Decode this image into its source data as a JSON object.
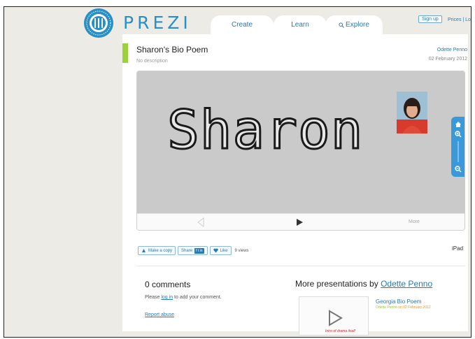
{
  "header": {
    "logo_text": "PREZI",
    "tabs": [
      {
        "label": "Create"
      },
      {
        "label": "Learn"
      },
      {
        "label": "Explore"
      }
    ],
    "signup_label": "Sign up",
    "links": "Prices | Lo"
  },
  "presentation": {
    "title": "Sharon's Bio Poem",
    "description": "No description",
    "author": "Odette Penno",
    "date": "02 February 2012"
  },
  "viewer": {
    "big_word": "Sharon",
    "more_label": "More"
  },
  "actions": {
    "copy_label": "Make a copy",
    "share_label": "Share",
    "share_badge": "f t in",
    "like_label": "Like",
    "views": "9 views",
    "ipad_label": "iPad"
  },
  "comments": {
    "title": "0 comments",
    "hint_prefix": "Please",
    "hint_link": "log in",
    "hint_suffix": "to add your comment.",
    "report_link": "Report abuse"
  },
  "more_presentations": {
    "title_prefix": "More presentations by",
    "author": "Odette Penno",
    "items": [
      {
        "title": "Georgia Bio Poem",
        "meta_by": "Odette Penno",
        "meta_date": "on 02 February 2012",
        "thumb_caption": "Intro of drama itself"
      }
    ]
  },
  "colors": {
    "brand_blue": "#2a8fc4",
    "accent_green": "#9bd23c",
    "page_bg": "#ecebe6"
  }
}
